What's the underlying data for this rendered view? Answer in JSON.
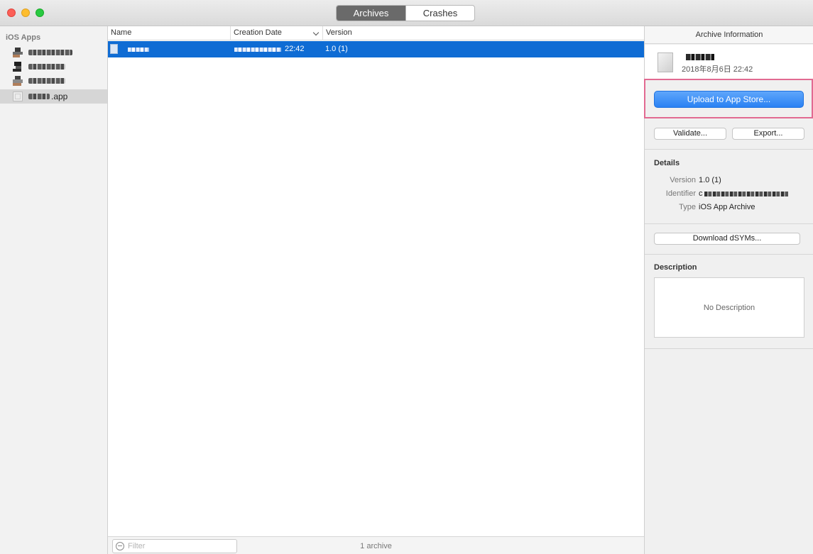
{
  "window": {
    "tabs": [
      {
        "label": "Archives",
        "active": true
      },
      {
        "label": "Crashes",
        "active": false
      }
    ]
  },
  "sidebar": {
    "header": "iOS Apps",
    "items": [
      {
        "label": "",
        "selected": false
      },
      {
        "label": "",
        "selected": false
      },
      {
        "label": "",
        "selected": false
      },
      {
        "label": ".app",
        "selected": true
      }
    ]
  },
  "list": {
    "columns": [
      "Name",
      "Creation Date",
      "Version"
    ],
    "rows": [
      {
        "name": "",
        "date_time": "22:42",
        "version": "1.0 (1)",
        "selected": true
      }
    ],
    "filter_placeholder": "Filter",
    "count": "1 archive"
  },
  "inspector": {
    "title": "Archive Information",
    "archive_date": "2018年8月6日 22:42",
    "upload_label": "Upload to App Store...",
    "validate_label": "Validate...",
    "export_label": "Export...",
    "details": {
      "title": "Details",
      "version_label": "Version",
      "version_value": "1.0 (1)",
      "identifier_label": "Identifier",
      "identifier_value": "c",
      "type_label": "Type",
      "type_value": "iOS App Archive"
    },
    "download_label": "Download dSYMs...",
    "description": {
      "title": "Description",
      "placeholder": "No Description"
    }
  },
  "colors": {
    "selection": "#0f6cd4",
    "primary_button": "#2a82f3",
    "highlight_border": "#e26a92",
    "close": "#fc5f57",
    "minimize": "#fdbd2e",
    "maximize": "#28c941"
  }
}
